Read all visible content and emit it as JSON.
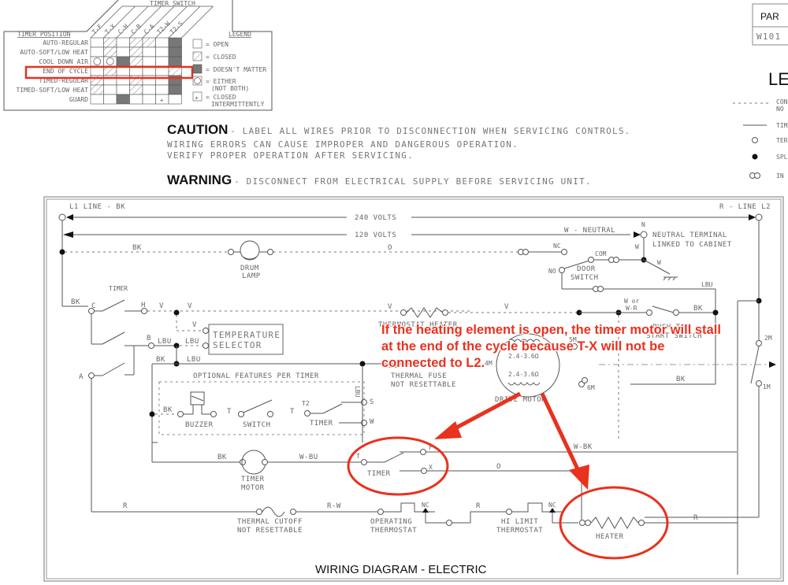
{
  "timer_chart": {
    "header": "TIMER SWITCH",
    "position_header": "TIMER POSITION",
    "columns": [
      "T-F",
      "T-X",
      "C-H",
      "C-B",
      "C-A",
      "T2-W",
      "T2-S"
    ],
    "rows": [
      {
        "label": "AUTO-REGULAR",
        "cells": [
          "open",
          "closed",
          "open",
          "closed",
          "closed",
          "open",
          "dontmatter"
        ]
      },
      {
        "label": "AUTO-SOFT/LOW HEAT",
        "cells": [
          "open",
          "closed",
          "open",
          "closed",
          "open",
          "open",
          "dontmatter"
        ]
      },
      {
        "label": "COOL DOWN   AIR",
        "cells": [
          "either",
          "either",
          "dontmatter",
          "closed",
          "open",
          "open",
          "dontmatter"
        ]
      },
      {
        "label": "END OF CYCLE",
        "cells": [
          "open",
          "closed",
          "open",
          "open",
          "open",
          "open",
          "closed"
        ]
      },
      {
        "label": "TIMED-REGULAR",
        "cells": [
          "closed",
          "open",
          "open",
          "closed",
          "open",
          "open",
          "dontmatter"
        ]
      },
      {
        "label": "TIMED-SOFT/LOW HEAT",
        "cells": [
          "closed",
          "open",
          "open",
          "closed",
          "open",
          "open",
          "dontmatter"
        ]
      },
      {
        "label": "GUARD",
        "cells": [
          "open",
          "open",
          "dontmatter",
          "open",
          "open",
          "intermittent",
          "open"
        ]
      }
    ],
    "highlighted_row": "END OF CYCLE",
    "legend_title": "LEGEND",
    "legend": [
      {
        "symbol": "open",
        "label": "= OPEN"
      },
      {
        "symbol": "closed",
        "label": "= CLOSED"
      },
      {
        "symbol": "dontmatter",
        "label": "= DOESN'T MATTER"
      },
      {
        "symbol": "either",
        "label": "= EITHER",
        "label2": "(NOT BOTH)"
      },
      {
        "symbol": "intermittent",
        "label": "= CLOSED",
        "label2": "INTERMITTENTLY"
      }
    ]
  },
  "part_box": {
    "header": "PAR",
    "value": "W101"
  },
  "right_legend": {
    "title": "LE",
    "items": [
      {
        "symbol": "dashed-line",
        "label": "CON",
        "label2": "NO"
      },
      {
        "symbol": "solid-line",
        "label": "TIM"
      },
      {
        "symbol": "terminal",
        "label": "TER"
      },
      {
        "symbol": "splice",
        "label": "SPL"
      },
      {
        "symbol": "connector",
        "label": "IN"
      }
    ]
  },
  "notices": {
    "caution_label": "CAUTION",
    "caution_lines": [
      "- LABEL ALL WIRES PRIOR TO DISCONNECTION WHEN SERVICING CONTROLS.",
      "WIRING ERRORS CAN CAUSE IMPROPER AND DANGEROUS OPERATION.",
      "VERIFY PROPER OPERATION AFTER SERVICING."
    ],
    "warning_label": "WARNING",
    "warning_text": "- DISCONNECT FROM ELECTRICAL SUPPLY BEFORE SERVICING UNIT."
  },
  "diagram": {
    "title": "WIRING DIAGRAM - ELECTRIC",
    "l1": "L1 LINE - BK",
    "l2": "R - LINE L2",
    "v240": "240 VOLTS",
    "v120": "120 VOLTS",
    "neutral": "W - NEUTRAL",
    "neutral_n": "N",
    "neutral_terminal": [
      "NEUTRAL TERMINAL",
      "LINKED TO CABINET"
    ],
    "drum_lamp": [
      "DRUM",
      "LAMP"
    ],
    "door_switch": [
      "DOOR",
      "SWITCH"
    ],
    "timer": "TIMER",
    "temp_selector": [
      "TEMPERATURE",
      "SELECTOR"
    ],
    "optional_features": "OPTIONAL FEATURES PER TIMER",
    "buzzer": "BUZZER",
    "switch": "SWITCH",
    "thermostat_heater": "THERMOSTAT HEATER",
    "push_to_start": [
      "PUSH TO",
      "START SWITCH"
    ],
    "thermal_fuse": [
      "THERMAL FUSE",
      "NOT RESETTABLE"
    ],
    "drive_motor": "DRIVE MOTOR",
    "motor_winding": "2.4-3.6Ω",
    "timer_motor": [
      "TIMER",
      "MOTOR"
    ],
    "thermal_cutoff": [
      "THERMAL CUTOFF",
      "NOT RESETTABLE"
    ],
    "operating_thermostat": [
      "OPERATING",
      "THERMOSTAT"
    ],
    "hi_limit_thermostat": [
      "HI LIMIT",
      "THERMOSTAT"
    ],
    "heater": "HEATER",
    "wire_labels": {
      "bk": "BK",
      "o": "O",
      "nc": "NC",
      "com": "COM",
      "no": "NO",
      "w": "W",
      "lbu": "LBU",
      "v": "V",
      "wr": "W or",
      "wr2": "W-R",
      "c": "C",
      "h": "H",
      "b": "B",
      "a": "A",
      "t": "T",
      "t2": "T2",
      "s": "S",
      "f": "F",
      "x": "X",
      "r": "R",
      "rw": "R-W",
      "wbu": "W-BU",
      "wbk": "W-BK",
      "m4": "4M",
      "m5": "5M",
      "m6": "6M",
      "m2": "2M",
      "m1": "1M"
    }
  },
  "annotation": {
    "text": "If the heating element is open, the timer motor will stall at the end of the cycle because T-X will not be connected to L2.",
    "color": "#e8321e"
  }
}
